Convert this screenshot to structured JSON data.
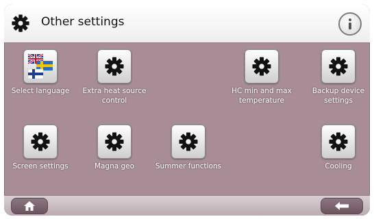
{
  "header": {
    "title": "Other settings",
    "title_icon": "gear-icon",
    "info_icon": "info-icon"
  },
  "tiles": [
    {
      "label": "Select language",
      "icon": "language-flags-icon"
    },
    {
      "label": "Extra heat source control",
      "icon": "gear-icon"
    },
    {
      "label": "HC min and max temperature",
      "icon": "gear-icon"
    },
    {
      "label": "Backup device settings",
      "icon": "gear-icon"
    },
    {
      "label": "Screen settings",
      "icon": "gear-icon"
    },
    {
      "label": "Magna geo",
      "icon": "gear-icon"
    },
    {
      "label": "Summer functions",
      "icon": "gear-icon"
    },
    {
      "label": "Cooling",
      "icon": "gear-icon"
    }
  ],
  "footer": {
    "home_icon": "home-icon",
    "back_icon": "back-arrow-icon"
  },
  "colors": {
    "background": "#a88d96",
    "header": "#ffffff",
    "label_text": "#ffffff",
    "nav_button": "#7a626d"
  }
}
